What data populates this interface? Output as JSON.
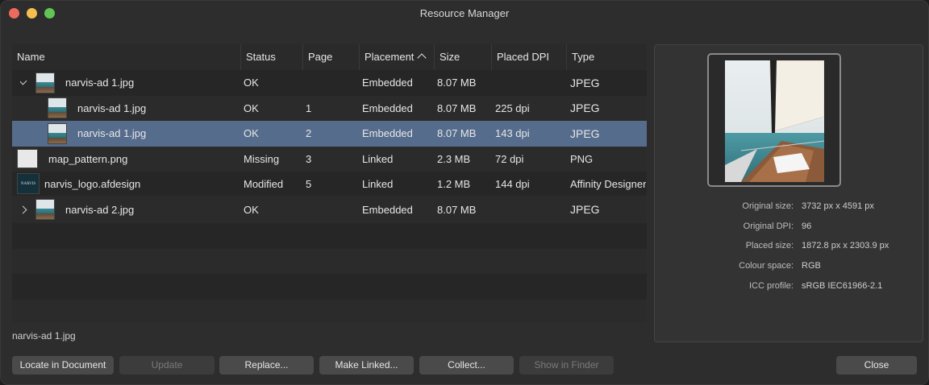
{
  "window": {
    "title": "Resource Manager"
  },
  "table": {
    "columns": {
      "name": "Name",
      "status": "Status",
      "page": "Page",
      "placement": "Placement",
      "size": "Size",
      "placed_dpi": "Placed DPI",
      "type": "Type"
    },
    "rows": [
      {
        "name": "narvis-ad 1.jpg",
        "status": "OK",
        "page": "",
        "placement": "Embedded",
        "size": "8.07 MB",
        "dpi": "",
        "type": "JPEG"
      },
      {
        "name": "narvis-ad 1.jpg",
        "status": "OK",
        "page": "1",
        "placement": "Embedded",
        "size": "8.07 MB",
        "dpi": "225 dpi",
        "type": "JPEG"
      },
      {
        "name": "narvis-ad 1.jpg",
        "status": "OK",
        "page": "2",
        "placement": "Embedded",
        "size": "8.07 MB",
        "dpi": "143 dpi",
        "type": "JPEG"
      },
      {
        "name": "map_pattern.png",
        "status": "Missing",
        "page": "3",
        "placement": "Linked",
        "size": "2.3 MB",
        "dpi": "72 dpi",
        "type": "PNG"
      },
      {
        "name": "narvis_logo.afdesign",
        "status": "Modified",
        "page": "5",
        "placement": "Linked",
        "size": "1.2 MB",
        "dpi": "144 dpi",
        "type": "Affinity Designer"
      },
      {
        "name": "narvis-ad 2.jpg",
        "status": "OK",
        "page": "",
        "placement": "Embedded",
        "size": "8.07 MB",
        "dpi": "",
        "type": "JPEG"
      }
    ],
    "logo_thumb_text": "NARVIS"
  },
  "selected_filename": "narvis-ad 1.jpg",
  "details": {
    "original_size_label": "Original size:",
    "original_size": "3732 px x 4591 px",
    "original_dpi_label": "Original DPI:",
    "original_dpi": "96",
    "placed_size_label": "Placed size:",
    "placed_size": "1872.8 px x 2303.9 px",
    "colour_space_label": "Colour space:",
    "colour_space": "RGB",
    "icc_profile_label": "ICC profile:",
    "icc_profile": "sRGB IEC61966-2.1"
  },
  "buttons": {
    "locate": "Locate in Document",
    "update": "Update",
    "replace": "Replace...",
    "make_linked": "Make Linked...",
    "collect": "Collect...",
    "show_in_finder": "Show in Finder",
    "close": "Close"
  },
  "colors": {
    "selected_row": "#566c8c",
    "window_bg": "#2d2d2d"
  }
}
